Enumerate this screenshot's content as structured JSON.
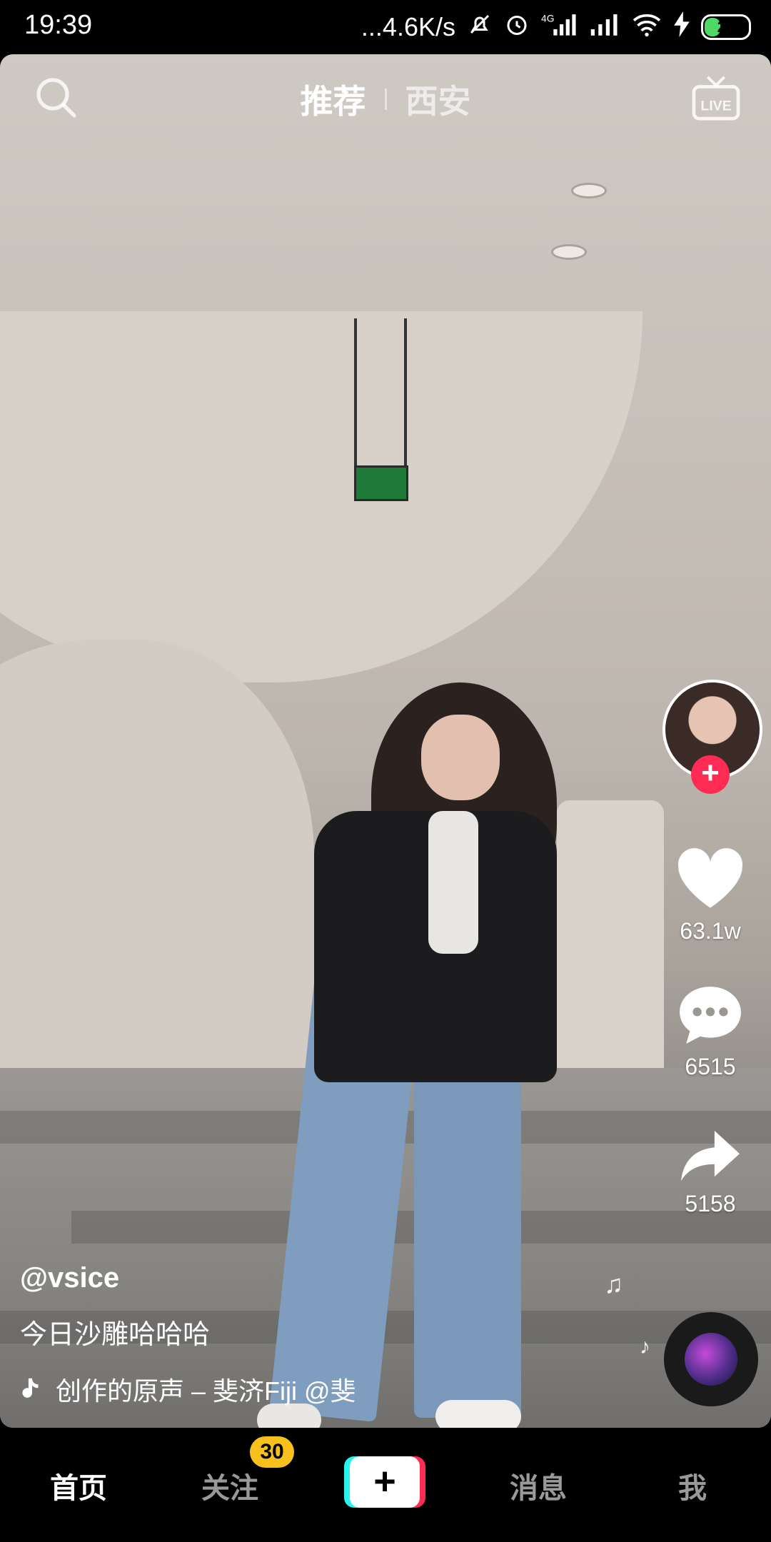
{
  "status_bar": {
    "time": "19:39",
    "network_speed": "...4.6K/s",
    "battery": "27",
    "icons": [
      "bell-mute-icon",
      "alarm-icon",
      "signal-4g-icon",
      "signal-icon",
      "wifi-icon",
      "charging-icon",
      "battery-icon"
    ]
  },
  "top_bar": {
    "tabs": [
      {
        "label": "推荐",
        "active": true
      },
      {
        "label": "西安",
        "active": false
      }
    ],
    "live_label": "LIVE"
  },
  "video": {
    "author": "@vsice",
    "caption": "今日沙雕哈哈哈",
    "music": "创作的原声 – 斐济Fiji    @斐"
  },
  "right_rail": {
    "likes": "63.1w",
    "comments": "6515",
    "shares": "5158"
  },
  "bottom_nav": {
    "home": "首页",
    "follow": "关注",
    "follow_badge": "30",
    "create": "+",
    "messages": "消息",
    "me": "我"
  },
  "colors": {
    "accent_red": "#fe2c55",
    "accent_cyan": "#25f4ee",
    "badge_yellow": "#f7c01c"
  }
}
